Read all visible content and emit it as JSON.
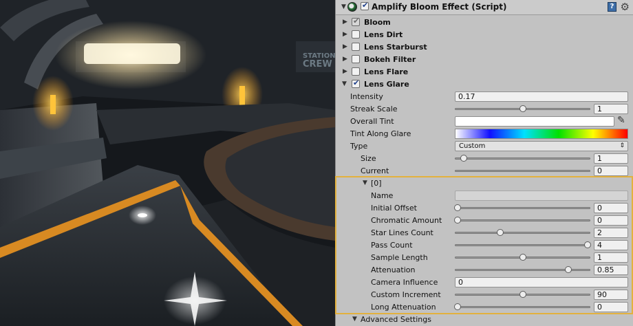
{
  "component": {
    "title": "Amplify Bloom Effect (Script)",
    "enabled": true,
    "help_icon": "help-book-icon",
    "gear_icon": "gear-icon"
  },
  "sections": [
    {
      "label": "Bloom",
      "expanded": false,
      "checked": true,
      "disabled": true
    },
    {
      "label": "Lens Dirt",
      "expanded": false,
      "checked": false
    },
    {
      "label": "Lens Starburst",
      "expanded": false,
      "checked": false
    },
    {
      "label": "Bokeh Filter",
      "expanded": false,
      "checked": false
    },
    {
      "label": "Lens Flare",
      "expanded": false,
      "checked": false
    },
    {
      "label": "Lens Glare",
      "expanded": true,
      "checked": true
    }
  ],
  "glare": {
    "intensity": {
      "label": "Intensity",
      "value": "0.17"
    },
    "streak_scale": {
      "label": "Streak Scale",
      "value": "1",
      "slider": 0.5
    },
    "overall_tint": {
      "label": "Overall Tint",
      "color": "#ffffff"
    },
    "tint_along_glare": {
      "label": "Tint Along Glare",
      "colors": [
        "#ffffff",
        "#1010ff",
        "#00e0ff",
        "#00e000",
        "#ffff00",
        "#ff0000"
      ]
    },
    "type": {
      "label": "Type",
      "value": "Custom"
    },
    "size": {
      "label": "Size",
      "value": "1",
      "slider": 0.05
    },
    "current": {
      "label": "Current",
      "value": "0",
      "slider": 0.0
    }
  },
  "element": {
    "header": "[0]",
    "name": {
      "label": "Name",
      "value": ""
    },
    "rows": [
      {
        "label": "Initial Offset",
        "value": "0",
        "slider": 0.0
      },
      {
        "label": "Chromatic Amount",
        "value": "0",
        "slider": 0.0
      },
      {
        "label": "Star Lines Count",
        "value": "2",
        "slider": 0.33
      },
      {
        "label": "Pass Count",
        "value": "4",
        "slider": 1.0
      },
      {
        "label": "Sample Length",
        "value": "1",
        "slider": 0.5
      },
      {
        "label": "Attenuation",
        "value": "0.85",
        "slider": 0.85
      }
    ],
    "camera_influence": {
      "label": "Camera Influence",
      "value": "0"
    },
    "rows2": [
      {
        "label": "Custom Increment",
        "value": "90",
        "slider": 0.5
      },
      {
        "label": "Long Attenuation",
        "value": "0",
        "slider": 0.0
      }
    ]
  },
  "advanced": {
    "label": "Advanced Settings"
  },
  "scene": {
    "sign_line1": "STATION",
    "sign_line2": "CREW"
  },
  "colors": {
    "highlight": "#e3b13d",
    "panel": "#c2c2c2",
    "checkmark": "#1e3f8a"
  }
}
